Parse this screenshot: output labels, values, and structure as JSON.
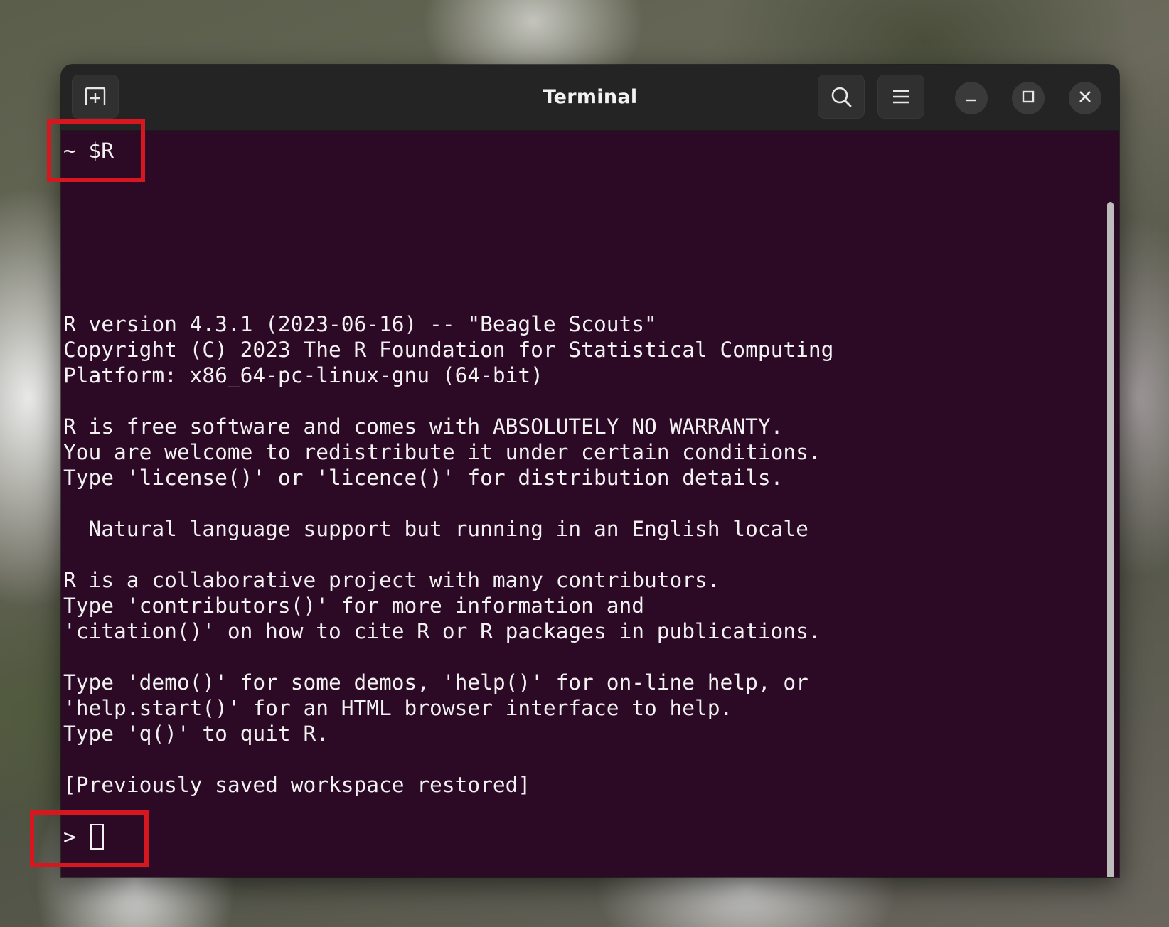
{
  "window": {
    "title": "Terminal"
  },
  "titlebar": {
    "new_tab_icon": "new-tab-icon",
    "search_icon": "search-icon",
    "menu_icon": "hamburger-menu-icon",
    "minimize_icon": "minimize-icon",
    "maximize_icon": "maximize-icon",
    "close_icon": "close-icon"
  },
  "terminal": {
    "prompt_command": "~ $R",
    "lines": [
      "R version 4.3.1 (2023-06-16) -- \"Beagle Scouts\"",
      "Copyright (C) 2023 The R Foundation for Statistical Computing",
      "Platform: x86_64-pc-linux-gnu (64-bit)",
      "",
      "R is free software and comes with ABSOLUTELY NO WARRANTY.",
      "You are welcome to redistribute it under certain conditions.",
      "Type 'license()' or 'licence()' for distribution details.",
      "",
      "  Natural language support but running in an English locale",
      "",
      "R is a collaborative project with many contributors.",
      "Type 'contributors()' for more information and",
      "'citation()' on how to cite R or R packages in publications.",
      "",
      "Type 'demo()' for some demos, 'help()' for on-line help, or",
      "'help.start()' for an HTML browser interface to help.",
      "Type 'q()' to quit R.",
      "",
      "[Previously saved workspace restored]"
    ],
    "r_prompt": "> "
  },
  "colors": {
    "terminal_bg": "#2c0a26",
    "titlebar_bg": "#242424",
    "text": "#f1f1f1",
    "highlight": "#d7171f"
  }
}
